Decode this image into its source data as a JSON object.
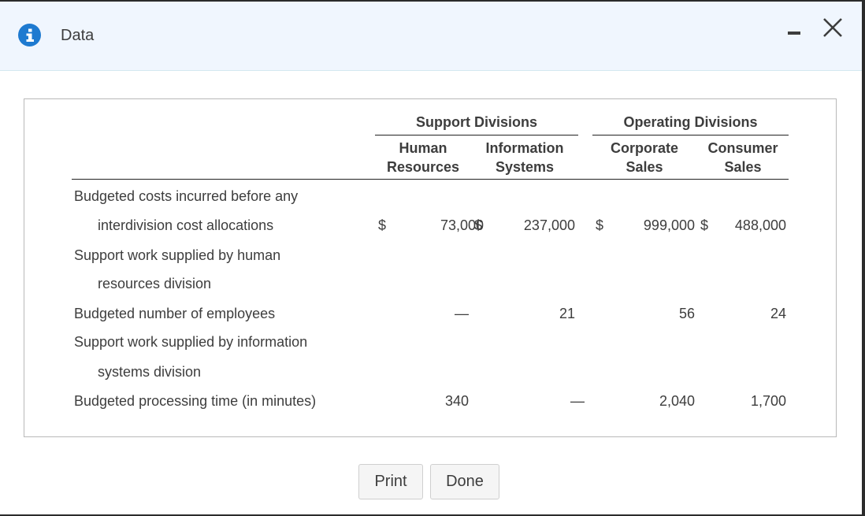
{
  "window": {
    "title": "Data",
    "icons": {
      "info": "info-icon",
      "minimize": "minimize-icon",
      "close": "close-icon"
    }
  },
  "table": {
    "groups": [
      {
        "label": "Support Divisions"
      },
      {
        "label": "Operating Divisions"
      }
    ],
    "columns": [
      {
        "line1": "Human",
        "line2": "Resources"
      },
      {
        "line1": "Information",
        "line2": "Systems"
      },
      {
        "line1": "Corporate",
        "line2": "Sales"
      },
      {
        "line1": "Consumer",
        "line2": "Sales"
      }
    ],
    "rows": [
      {
        "label": "Budgeted costs incurred before any",
        "indent": false,
        "values": []
      },
      {
        "label": "interdivision cost allocations",
        "indent": true,
        "values": [
          "73,000",
          "237,000",
          "999,000",
          "488,000"
        ],
        "currency": "$"
      },
      {
        "label": "Support work supplied by human",
        "indent": false,
        "values": []
      },
      {
        "label": "resources division",
        "indent": true,
        "values": []
      },
      {
        "label": "Budgeted number of employees",
        "indent": false,
        "values": [
          "—",
          "21",
          "56",
          "24"
        ]
      },
      {
        "label": "Support work supplied by information",
        "indent": false,
        "values": []
      },
      {
        "label": "systems division",
        "indent": true,
        "values": []
      },
      {
        "label": "Budgeted processing time (in minutes)",
        "indent": false,
        "values": [
          "340",
          "—",
          "2,040",
          "1,700"
        ]
      }
    ]
  },
  "buttons": {
    "print": "Print",
    "done": "Done"
  },
  "colors": {
    "header_bg": "#f0f6fe",
    "info_icon": "#1e7ad0",
    "text": "#3d3d3d"
  }
}
